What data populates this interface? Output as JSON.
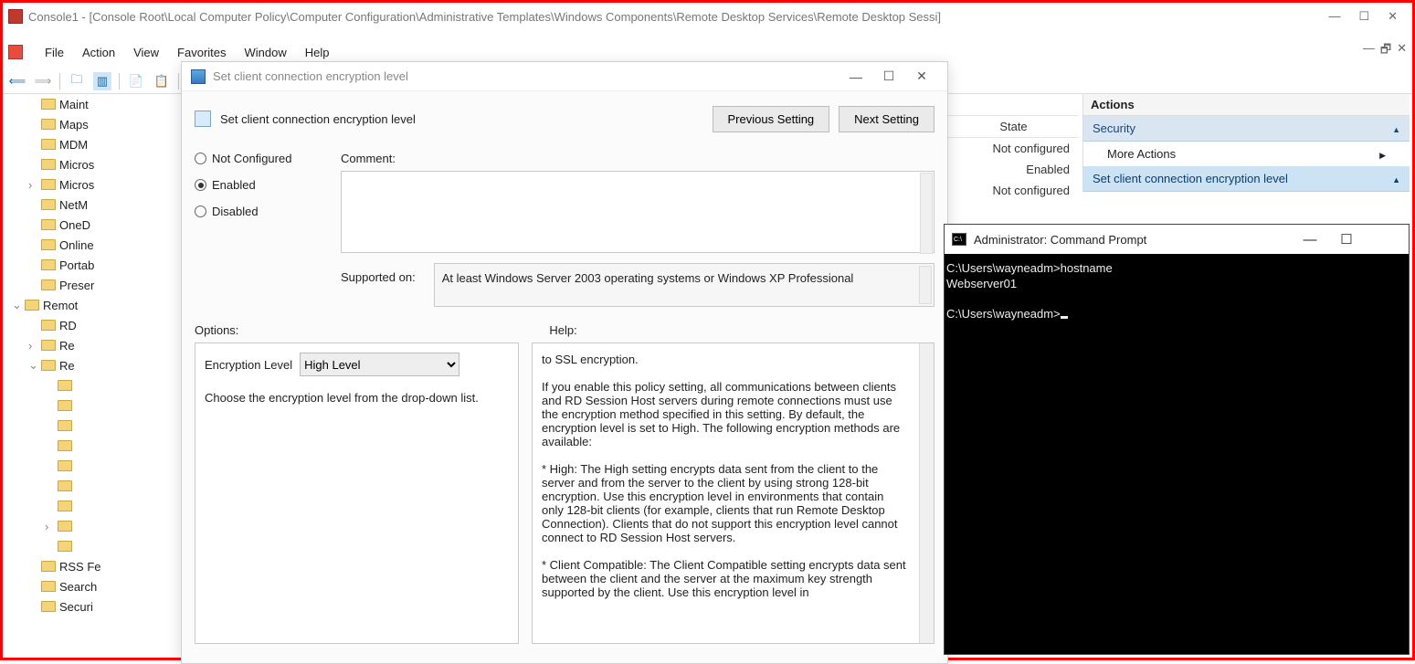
{
  "title": "Console1 - [Console Root\\Local Computer Policy\\Computer Configuration\\Administrative Templates\\Windows Components\\Remote Desktop Services\\Remote Desktop Sessi]",
  "menu": [
    "File",
    "Action",
    "View",
    "Favorites",
    "Window",
    "Help"
  ],
  "tree": [
    {
      "indent": 1,
      "label": "Maint"
    },
    {
      "indent": 1,
      "label": "Maps"
    },
    {
      "indent": 1,
      "label": "MDM"
    },
    {
      "indent": 1,
      "label": "Micros"
    },
    {
      "indent": 1,
      "toggle": ">",
      "label": "Micros"
    },
    {
      "indent": 1,
      "label": "NetM"
    },
    {
      "indent": 1,
      "label": "OneD"
    },
    {
      "indent": 1,
      "label": "Online"
    },
    {
      "indent": 1,
      "label": "Portab"
    },
    {
      "indent": 1,
      "label": "Preser"
    },
    {
      "indent": 0,
      "toggle": "v",
      "label": "Remot"
    },
    {
      "indent": 1,
      "label": "RD"
    },
    {
      "indent": 1,
      "toggle": ">",
      "label": "Re"
    },
    {
      "indent": 1,
      "toggle": "v",
      "label": "Re"
    },
    {
      "indent": 2,
      "label": ""
    },
    {
      "indent": 2,
      "label": ""
    },
    {
      "indent": 2,
      "label": ""
    },
    {
      "indent": 2,
      "label": ""
    },
    {
      "indent": 2,
      "label": ""
    },
    {
      "indent": 2,
      "label": ""
    },
    {
      "indent": 2,
      "label": ""
    },
    {
      "indent": 2,
      "toggle": ">",
      "label": ""
    },
    {
      "indent": 2,
      "label": ""
    },
    {
      "indent": 1,
      "label": "RSS Fe"
    },
    {
      "indent": 1,
      "label": "Search"
    },
    {
      "indent": 1,
      "label": "Securi"
    }
  ],
  "list": {
    "state_header": "State",
    "rows": [
      "Not configured",
      "Enabled",
      "Not configured"
    ]
  },
  "actions": {
    "header": "Actions",
    "group1": "Security",
    "item1": "More Actions",
    "group2": "Set client connection encryption level"
  },
  "dialog": {
    "title": "Set client connection encryption level",
    "heading": "Set client connection encryption level",
    "prev": "Previous Setting",
    "next": "Next Setting",
    "r1": "Not Configured",
    "r2": "Enabled",
    "r3": "Disabled",
    "comment": "Comment:",
    "supported": "Supported on:",
    "supported_txt": "At least Windows Server 2003 operating systems or Windows XP Professional",
    "options": "Options:",
    "help": "Help:",
    "enc_lbl": "Encryption Level",
    "enc_val": "High Level",
    "enc_hint": "Choose the encryption level from the drop-down list.",
    "help_text": "to SSL encryption.\n\nIf you enable this policy setting, all communications between clients and RD Session Host servers during remote connections must use the encryption method specified in this setting. By default, the encryption level is set to High. The following encryption methods are available:\n\n* High: The High setting encrypts data sent from the client to the server and from the server to the client by using strong 128-bit encryption. Use this encryption level in environments that contain only 128-bit clients (for example, clients that run Remote Desktop Connection). Clients that do not support this encryption level cannot connect to RD Session Host servers.\n\n* Client Compatible: The Client Compatible setting encrypts data sent between the client and the server at the maximum key strength supported by the client. Use this encryption level in"
  },
  "cmd": {
    "title": "Administrator: Command Prompt",
    "l1": "C:\\Users\\wayneadm>hostname",
    "l2": "Webserver01",
    "l3": "C:\\Users\\wayneadm>"
  }
}
